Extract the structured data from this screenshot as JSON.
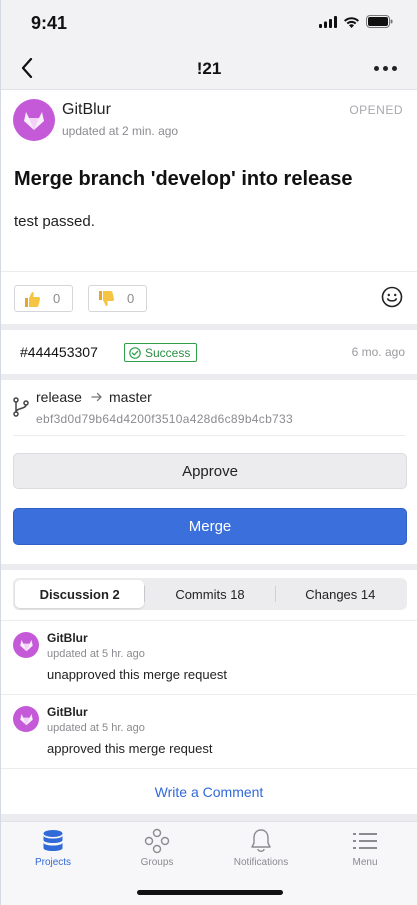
{
  "status_bar": {
    "time": "9:41"
  },
  "nav": {
    "title": "!21"
  },
  "merge_request": {
    "author": "GitBlur",
    "updated": "updated at 2 min. ago",
    "state": "OPENED",
    "title": "Merge branch 'develop' into release",
    "description": "test passed.",
    "reactions": {
      "thumbs_up": "0",
      "thumbs_down": "0"
    }
  },
  "pipeline": {
    "id": "#444453307",
    "status": "Success",
    "time": "6 mo. ago",
    "status_color": "#2fa04a"
  },
  "branches": {
    "source": "release",
    "target": "master",
    "sha": "ebf3d0d79b64d4200f3510a428d6c89b4cb733"
  },
  "actions": {
    "approve_label": "Approve",
    "merge_label": "Merge",
    "merge_color": "#3b6fdc"
  },
  "tabs": [
    {
      "label": "Discussion 2",
      "active": true
    },
    {
      "label": "Commits 18",
      "active": false
    },
    {
      "label": "Changes 14",
      "active": false
    }
  ],
  "notes": [
    {
      "author": "GitBlur",
      "time": "updated at 5 hr. ago",
      "body": "unapproved this merge request"
    },
    {
      "author": "GitBlur",
      "time": "updated at 5 hr. ago",
      "body": "approved this merge request"
    }
  ],
  "write_comment_label": "Write a Comment",
  "tab_bar": [
    {
      "label": "Projects",
      "icon": "database-icon",
      "active": true
    },
    {
      "label": "Groups",
      "icon": "groups-icon",
      "active": false
    },
    {
      "label": "Notifications",
      "icon": "bell-icon",
      "active": false
    },
    {
      "label": "Menu",
      "icon": "menu-icon",
      "active": false
    }
  ],
  "colors": {
    "accent": "#3169d8",
    "avatar": "#c45ad8"
  }
}
